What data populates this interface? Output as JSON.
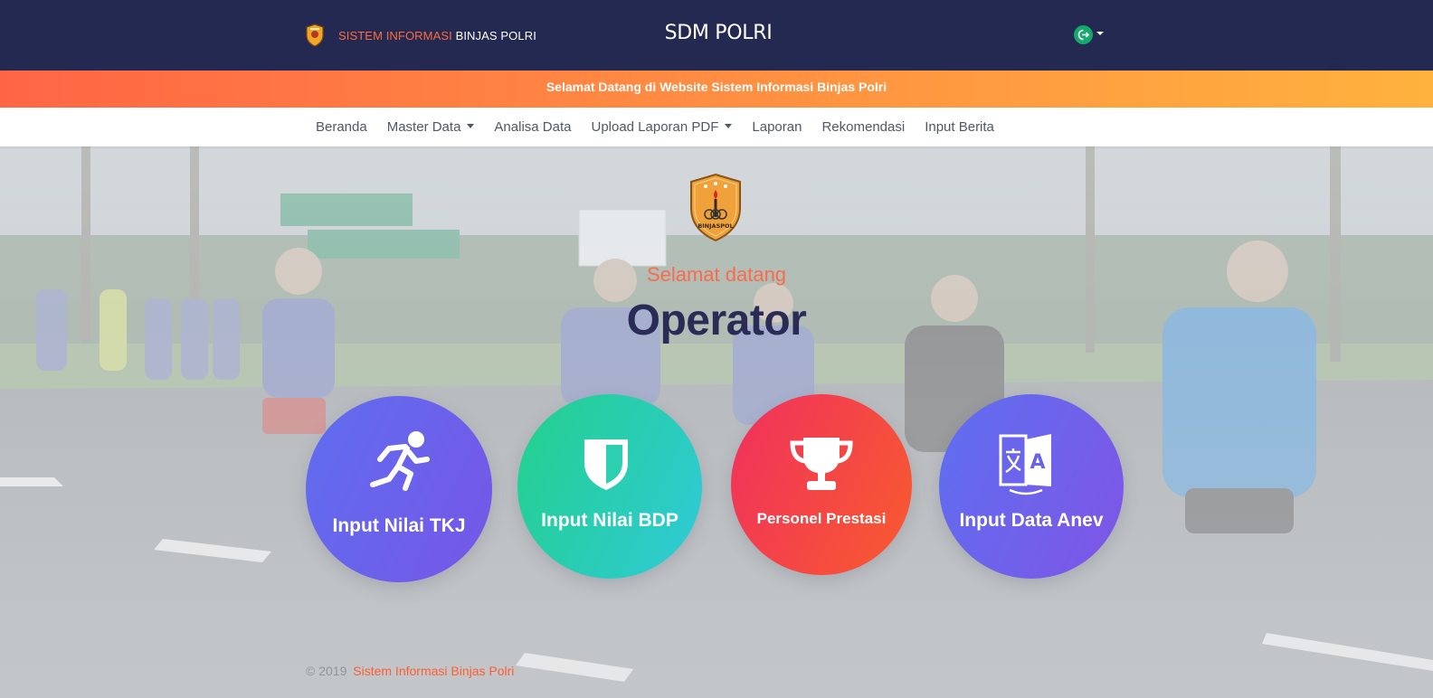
{
  "header": {
    "brand_highlight": "SISTEM INFORMASI",
    "brand_rest": "BINJAS POLRI",
    "title": "SDM POLRI"
  },
  "banner": {
    "text": "Selamat Datang di Website Sistem Informasi Binjas Polri"
  },
  "nav": {
    "items": [
      {
        "label": "Beranda",
        "dropdown": false
      },
      {
        "label": "Master Data",
        "dropdown": true
      },
      {
        "label": "Analisa Data",
        "dropdown": false
      },
      {
        "label": "Upload Laporan PDF",
        "dropdown": true
      },
      {
        "label": "Laporan",
        "dropdown": false
      },
      {
        "label": "Rekomendasi",
        "dropdown": false
      },
      {
        "label": "Input Berita",
        "dropdown": false
      }
    ]
  },
  "hero": {
    "emblem_text": "BINJASPOL",
    "welcome": "Selamat datang",
    "role": "Operator"
  },
  "actions": [
    {
      "label": "Input Nilai TKJ",
      "icon": "running-icon"
    },
    {
      "label": "Input Nilai BDP",
      "icon": "shield-icon"
    },
    {
      "label": "Personel Prestasi",
      "icon": "trophy-icon"
    },
    {
      "label": "Input Data Anev",
      "icon": "language-icon"
    }
  ],
  "footer": {
    "copyright": "© 2019",
    "site": "Sistem Informasi Binjas Polri"
  },
  "colors": {
    "topbar": "#181e48",
    "accent_orange": "#ff6a3d",
    "operator_text": "#2a2c55"
  }
}
